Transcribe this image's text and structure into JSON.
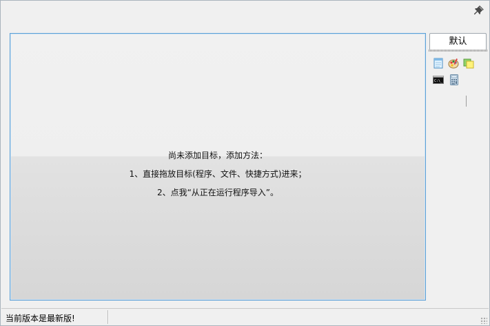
{
  "tabs": {
    "default_label": "默认"
  },
  "hint": {
    "line1": "尚未添加目标，添加方法：",
    "line2": "1、直接拖放目标(程序、文件、快捷方式)进来；",
    "line3": "2、点我“从正在运行程序导入”。"
  },
  "status": {
    "version_text": "当前版本是最新版!"
  },
  "icons": [
    "notepad-icon",
    "paint-icon",
    "sticky-notes-icon",
    "cmd-icon",
    "calculator-icon"
  ],
  "colors": {
    "panel_border": "#5b9fd6",
    "background": "#f0f0f0"
  }
}
